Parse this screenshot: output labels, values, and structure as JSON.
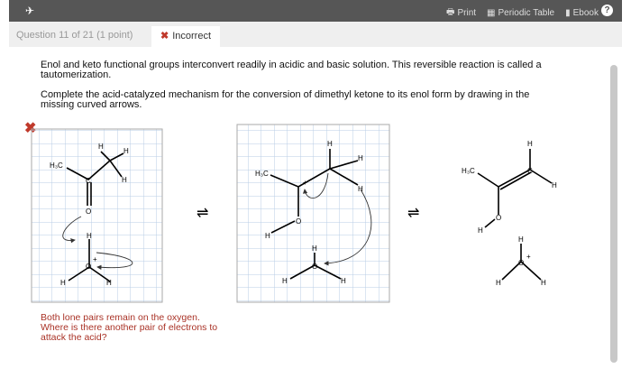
{
  "topbar": {
    "logo_icon": "bird-logo-icon",
    "print": "Print",
    "periodic_table": "Periodic Table",
    "ebook": "Ebook",
    "help": "?"
  },
  "tabs": {
    "question": "Question 11 of 21 (1 point)",
    "status": "Incorrect"
  },
  "question": {
    "p1": "Enol and keto functional groups interconvert readily in acidic and basic solution. This reversible reaction is called a tautomerization.",
    "p2": "Complete the acid-catalyzed mechanism for the conversion of dimethyl ketone to its enol form by drawing in the missing curved arrows."
  },
  "feedback": "Both lone pairs remain on the oxygen. Where is there another pair of electrons to attack the acid?",
  "equilibrium": "⇌",
  "labels": {
    "H": "H",
    "H3C": "H₃C",
    "C": "C",
    "O": "O",
    "plus": "+"
  },
  "colors": {
    "topbar": "#565656",
    "error": "#c0392b",
    "feedback": "#a93226",
    "grid": "#b8cde6"
  }
}
